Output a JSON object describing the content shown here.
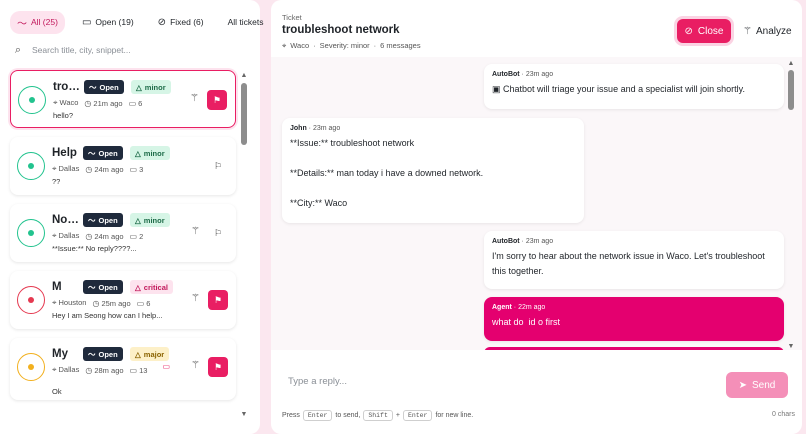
{
  "filters": {
    "all": "All (25)",
    "open": "Open (19)",
    "fixed": "Fixed (6)",
    "dropdown": "All tickets"
  },
  "search": {
    "placeholder": "Search title, city, snippet..."
  },
  "tickets": [
    {
      "title": "troubleshoot network",
      "status": "Open",
      "severity": "minor",
      "city": "Waco",
      "age": "21m ago",
      "messages": "6",
      "snippet": "hello?",
      "flagged": true,
      "selected": true,
      "color": "#22c38e"
    },
    {
      "title": "Help",
      "status": "Open",
      "severity": "minor",
      "city": "Dallas",
      "age": "24m ago",
      "messages": "3",
      "snippet": "??",
      "flagged": false,
      "selected": false,
      "color": "#22c38e"
    },
    {
      "title": "No reply",
      "status": "Open",
      "severity": "minor",
      "city": "Dallas",
      "age": "24m ago",
      "messages": "2",
      "snippet": "**Issue:** No reply????...",
      "flagged": false,
      "selected": false,
      "color": "#22c38e"
    },
    {
      "title": "M",
      "status": "Open",
      "severity": "critical",
      "city": "Houston",
      "age": "25m ago",
      "messages": "6",
      "snippet": "Hey I am Seong how can I help...",
      "flagged": true,
      "selected": false,
      "color": "#e53950"
    },
    {
      "title": "My",
      "status": "Open",
      "severity": "major",
      "city": "Dallas",
      "age": "28m ago",
      "messages": "13",
      "snippet": "Ok",
      "flagged": true,
      "selected": false,
      "color": "#f2b01e"
    }
  ],
  "ticket": {
    "label": "Ticket",
    "title": "troubleshoot network",
    "city": "Waco",
    "severity": "Severity: minor",
    "messages": "6 messages",
    "close_label": "Close",
    "analyze_label": "Analyze"
  },
  "messages": [
    {
      "author": "AutoBot",
      "time": "23m ago",
      "text": "Chatbot will triage your issue and a specialist will join shortly.",
      "side": "right",
      "kind": "bot"
    },
    {
      "author": "John",
      "time": "23m ago",
      "text": "**Issue:** troubleshoot network\n\n**Details:** man today i have a downed network.\n\n**City:** Waco",
      "side": "left",
      "kind": "user"
    },
    {
      "author": "AutoBot",
      "time": "23m ago",
      "text": "I'm sorry to hear about the network issue in Waco. Let's troubleshoot this together.",
      "side": "right",
      "kind": "bot"
    },
    {
      "author": "Agent",
      "time": "22m ago",
      "text": "what do  id o first",
      "side": "right",
      "kind": "agent"
    }
  ],
  "composer": {
    "placeholder": "Type a reply...",
    "send_label": "Send",
    "hint_press": "Press",
    "key_enter": "Enter",
    "hint_to_send": "to send,",
    "key_shift": "Shift",
    "plus": "+",
    "hint_newline": "for new line.",
    "char_count": "0 chars"
  },
  "colors": {
    "accent": "#e91e63",
    "agent_bubble": "#e4006f",
    "background": "#fbe7ef"
  }
}
